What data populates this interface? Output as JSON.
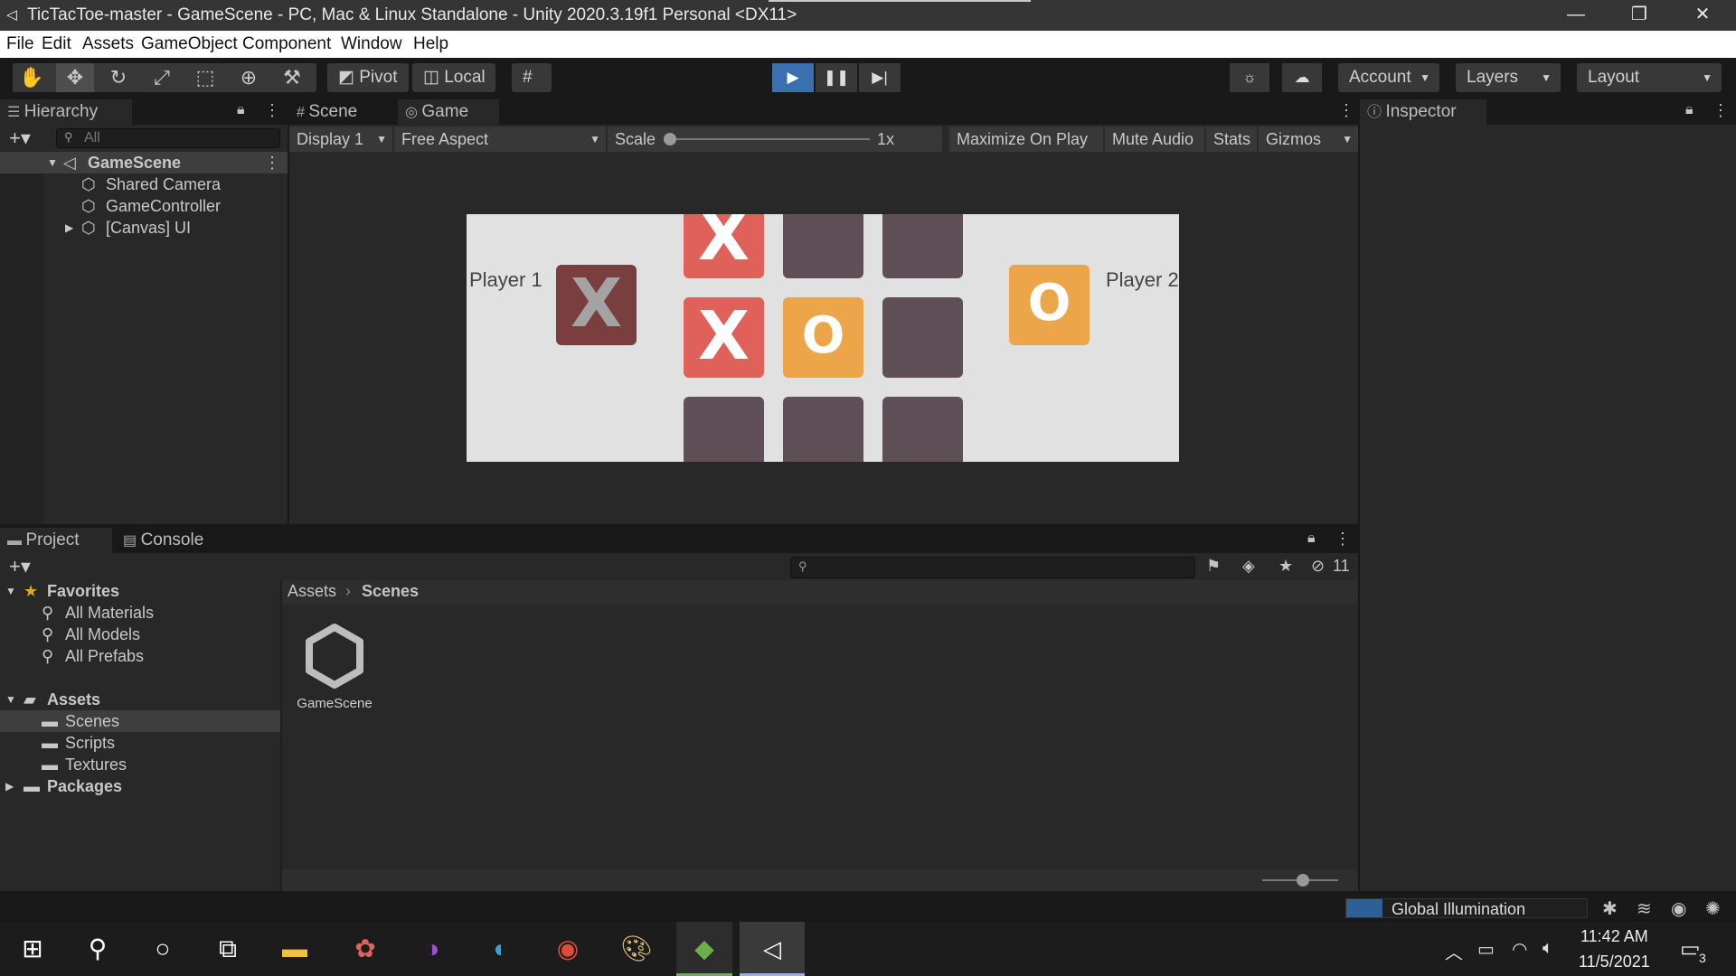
{
  "window": {
    "title": "TicTacToe-master - GameScene - PC, Mac & Linux Standalone - Unity 2020.3.19f1 Personal <DX11>",
    "app_icon": "unity-icon",
    "controls": {
      "minimize": "—",
      "maximize": "❐",
      "close": "✕"
    }
  },
  "menu": {
    "file": "File",
    "edit": "Edit",
    "assets": "Assets",
    "gameobject": "GameObject",
    "component": "Component",
    "window": "Window",
    "help": "Help"
  },
  "toolbar": {
    "tools": [
      "hand-tool",
      "move-tool",
      "rotate-tool",
      "scale-tool",
      "rect-tool",
      "transform-tool",
      "custom-tool"
    ],
    "pivot": "Pivot",
    "local": "Local",
    "account": "Account",
    "layers": "Layers",
    "layout": "Layout"
  },
  "hierarchy": {
    "tab": "Hierarchy",
    "search_placeholder": "All",
    "scene": "GameScene",
    "items": [
      "Shared Camera",
      "GameController",
      "[Canvas] UI"
    ]
  },
  "scene_tabs": {
    "scene": "Scene",
    "game": "Game"
  },
  "game_controls": {
    "display": "Display 1",
    "aspect": "Free Aspect",
    "scale_label": "Scale",
    "scale_value": "1x",
    "maximize": "Maximize On Play",
    "mute": "Mute Audio",
    "stats": "Stats",
    "gizmos": "Gizmos"
  },
  "game": {
    "player1": "Player 1",
    "player2": "Player 2",
    "player1_symbol": "X",
    "player2_symbol": "O",
    "board": [
      "X",
      "",
      "",
      "X",
      "O",
      "",
      "",
      "",
      ""
    ],
    "colors": {
      "x": "#e0615a",
      "o": "#eda549",
      "empty": "#5e5056",
      "p1": "#7a3e3e",
      "bg": "#e1e1e1"
    }
  },
  "inspector": {
    "tab": "Inspector"
  },
  "project": {
    "tab_project": "Project",
    "tab_console": "Console",
    "hidden_count": "11",
    "favorites": "Favorites",
    "fav_items": [
      "All Materials",
      "All Models",
      "All Prefabs"
    ],
    "assets": "Assets",
    "asset_folders": [
      "Scenes",
      "Scripts",
      "Textures"
    ],
    "packages": "Packages",
    "breadcrumb_root": "Assets",
    "breadcrumb_current": "Scenes",
    "files": [
      "GameScene"
    ]
  },
  "statusbar": {
    "gi": "Global Illumination"
  },
  "taskbar": {
    "time": "11:42 AM",
    "date": "11/5/2021",
    "notifications": "3"
  }
}
